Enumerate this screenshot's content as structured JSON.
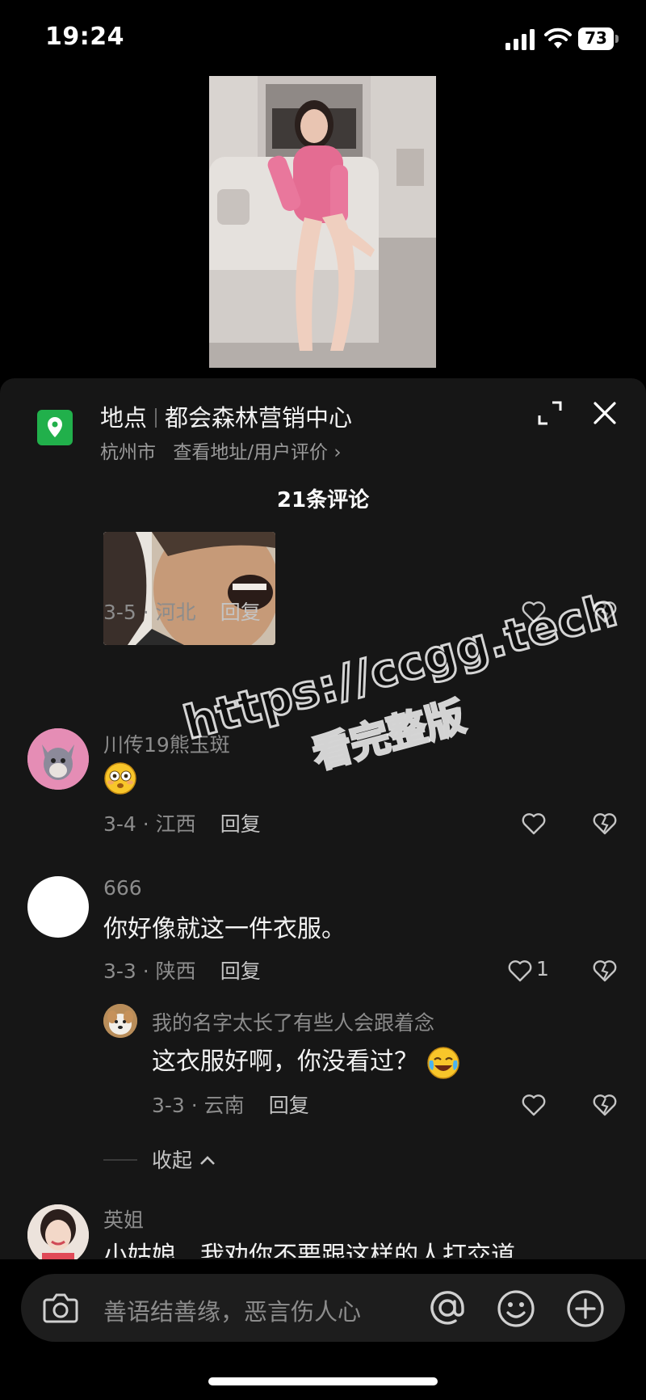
{
  "status_bar": {
    "time": "19:24",
    "battery": "73"
  },
  "location": {
    "label": "地点",
    "name": "都会森林营销中心",
    "city": "杭州市",
    "link": "查看地址/用户评价 ›"
  },
  "comments_header": {
    "count_label": "21条评论"
  },
  "comments": [
    {
      "meta": "3-5 · 河北",
      "reply": "回复"
    },
    {
      "username": "川传19熊玉斑",
      "text": "😳",
      "meta": "3-4 · 江西",
      "reply": "回复"
    },
    {
      "username": "666",
      "text": "你好像就这一件衣服。",
      "meta": "3-3 · 陕西",
      "reply": "回复",
      "likes": "1"
    },
    {
      "username": "我的名字太长了有些人会跟着念",
      "text": "这衣服好啊，你没看过？",
      "emoji": "😂",
      "meta": "3-3 · 云南",
      "reply": "回复"
    },
    {
      "username": "英姐",
      "text": "小姑娘，我劝你不要跟这样的人打交道"
    }
  ],
  "collapse_label": "收起",
  "input": {
    "placeholder": "善语结善缘，恶言伤人心"
  },
  "watermark": {
    "line1": "https://ccgg.tech",
    "line2": "看完整版"
  },
  "colors": {
    "sheet_bg": "#161616",
    "location_pin": "#21b04b",
    "text_primary": "#f2f2f2",
    "text_secondary": "#8c8c8c"
  }
}
